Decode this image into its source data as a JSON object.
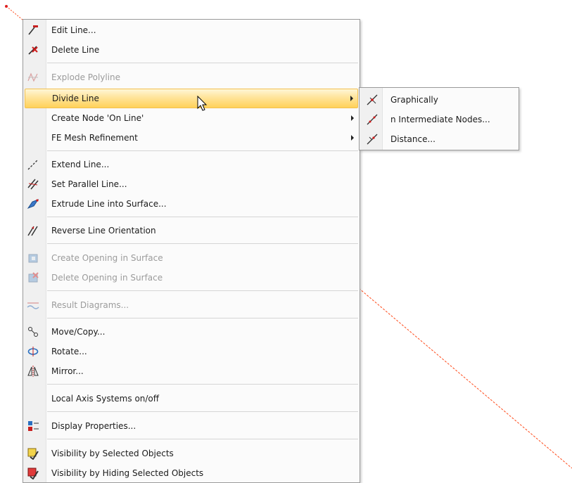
{
  "context_menu": {
    "items": [
      {
        "label": "Edit Line...",
        "icon": "edit-line-icon"
      },
      {
        "label": "Delete Line",
        "icon": "delete-line-icon"
      },
      {
        "label": "Explode Polyline",
        "icon": "explode-polyline-icon",
        "disabled": true
      },
      {
        "label": "Divide Line",
        "submenu": true,
        "highlighted": true
      },
      {
        "label": "Create Node 'On Line'",
        "submenu": true
      },
      {
        "label": "FE Mesh Refinement",
        "submenu": true
      },
      {
        "label": "Extend Line...",
        "icon": "extend-line-icon"
      },
      {
        "label": "Set Parallel Line...",
        "icon": "parallel-line-icon"
      },
      {
        "label": "Extrude Line into Surface...",
        "icon": "extrude-surface-icon"
      },
      {
        "label": "Reverse Line Orientation",
        "icon": "reverse-orientation-icon"
      },
      {
        "label": "Create Opening in Surface",
        "icon": "create-opening-icon",
        "disabled": true
      },
      {
        "label": "Delete Opening in Surface",
        "icon": "delete-opening-icon",
        "disabled": true
      },
      {
        "label": "Result Diagrams...",
        "icon": "result-diagrams-icon",
        "disabled": true
      },
      {
        "label": "Move/Copy...",
        "icon": "move-copy-icon"
      },
      {
        "label": "Rotate...",
        "icon": "rotate-icon"
      },
      {
        "label": "Mirror...",
        "icon": "mirror-icon"
      },
      {
        "label": "Local Axis Systems on/off"
      },
      {
        "label": "Display Properties...",
        "icon": "display-properties-icon"
      },
      {
        "label": "Visibility by Selected Objects",
        "icon": "visibility-selected-icon"
      },
      {
        "label": "Visibility by Hiding Selected Objects",
        "icon": "visibility-hiding-icon"
      }
    ]
  },
  "divide_submenu": {
    "items": [
      {
        "label": "Graphically",
        "icon": "divide-graphically-icon"
      },
      {
        "label": "n Intermediate Nodes...",
        "icon": "intermediate-nodes-icon"
      },
      {
        "label": "Distance...",
        "icon": "distance-icon"
      }
    ]
  },
  "colors": {
    "highlight": "#ffd15a",
    "line": "#ff4a1a",
    "disabled_text": "#9b9b9b"
  }
}
